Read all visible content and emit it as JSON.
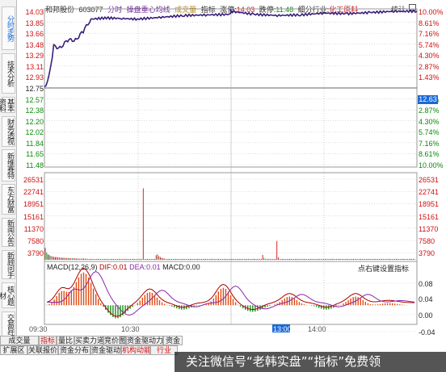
{
  "header": {
    "stock_name": "和邦股份",
    "stock_code": "603077",
    "time_label": "分时",
    "avg_label": "操盘重心均线",
    "vol_label": "成交量",
    "index_label": "指标",
    "up_label": "涨停:",
    "up_value": "14.03",
    "down_label": "跌停:",
    "down_value": "11.48",
    "industry_label": "细分行业:",
    "industry_value": "化工原料",
    "stat_button": "统计"
  },
  "sidebar": {
    "items": [
      "分时走势",
      "技术分析",
      "基本资料",
      "财务透视",
      "新维赛特",
      "东方财富",
      "新闻公告",
      "新顾问手",
      "核心题材",
      "交易异动",
      "公告"
    ]
  },
  "price_axis": {
    "left": [
      "14.03",
      "13.85",
      "13.66",
      "13.48",
      "13.29",
      "13.11",
      "12.93",
      "12.75",
      "12.57",
      "12.38",
      "12.20",
      "12.02",
      "11.84",
      "11.65",
      "11.48"
    ],
    "right": [
      "10.00%",
      "8.61%",
      "7.16%",
      "5.74%",
      "4.30%",
      "2.87%",
      "1.43%",
      "12.63",
      "1.43%",
      "2.87%",
      "4.30%",
      "5.74%",
      "7.16%",
      "8.61%",
      "10.00%"
    ],
    "current_price": "12.63"
  },
  "volume_axis": {
    "left": [
      "26531",
      "22741",
      "18951",
      "15161",
      "11370",
      "7580",
      "3790"
    ],
    "right": [
      "26531",
      "22741",
      "18951",
      "15161",
      "11370",
      "7580",
      "3790"
    ]
  },
  "macd": {
    "title": "MACD(12,26,9)",
    "dif": "DIF:0.01",
    "dea": "DEA:0.01",
    "macd": "MACD:0.00",
    "hint": "点右键设置指标",
    "right_axis": [
      "0.08",
      "0.04",
      "0.00",
      "-0.04"
    ]
  },
  "time_axis": [
    "09:30",
    "10:30",
    "13:00",
    "14:00"
  ],
  "tabs_row1": [
    {
      "label": "成交量",
      "red": false
    },
    {
      "label": "指标",
      "red": true
    },
    {
      "label": "量比",
      "red": false
    },
    {
      "label": "买卖力道",
      "red": false
    },
    {
      "label": "竞价图",
      "red": false
    },
    {
      "label": "资金驱动力",
      "red": false
    },
    {
      "label": "资金",
      "red": false
    }
  ],
  "tabs_row2": [
    {
      "label": "扩展区",
      "red": false
    },
    {
      "label": "关联报价",
      "red": false
    },
    {
      "label": "资金分布",
      "red": false
    },
    {
      "label": "资金驱动",
      "red": false
    },
    {
      "label": "机构动能",
      "red": true
    },
    {
      "label": "行业",
      "red": true
    }
  ],
  "watermark": "关注微信号“老韩实盘”“指标”免费领",
  "colors": {
    "price_line": "#3a1f7a",
    "up": "#d01010",
    "down": "#0a8a0a",
    "dif": "#b00000",
    "dea": "#8a2aa8",
    "accent": "#1a6ad6"
  },
  "chart_data": {
    "type": "line",
    "price_series": {
      "x": [
        "09:30",
        "09:33",
        "09:36",
        "09:40",
        "09:45",
        "09:50",
        "09:55",
        "10:00",
        "10:10",
        "10:20",
        "10:30",
        "10:45",
        "11:00",
        "11:15",
        "11:30",
        "13:00",
        "13:15",
        "13:30",
        "13:45",
        "14:00",
        "14:15",
        "14:30",
        "14:45",
        "15:00"
      ],
      "y": [
        12.75,
        12.95,
        13.45,
        13.42,
        13.55,
        13.55,
        13.7,
        13.9,
        13.92,
        13.91,
        13.9,
        13.93,
        13.96,
        13.97,
        13.98,
        14.03,
        13.98,
        13.96,
        13.97,
        14.0,
        13.99,
        14.01,
        14.03,
        14.03
      ]
    },
    "ylim": [
      11.48,
      14.03
    ],
    "prev_close": 12.75,
    "volume": {
      "max": 26531,
      "values": [
        3900,
        2400,
        1800,
        1500,
        1300,
        1100,
        1000,
        900,
        900,
        800,
        800,
        700,
        700,
        700,
        600,
        600,
        600,
        500,
        500,
        500,
        500,
        500,
        400,
        400,
        400,
        400,
        400,
        400,
        400,
        400,
        300,
        300,
        300,
        300,
        300,
        300,
        300,
        300,
        300,
        300,
        300,
        300,
        300,
        300,
        300,
        300,
        300,
        300,
        300,
        300,
        300,
        300,
        300,
        300,
        300,
        300,
        300,
        300,
        300,
        300,
        300,
        300,
        300,
        300,
        300,
        300,
        300,
        300,
        300,
        23500,
        300,
        300,
        300,
        300,
        300,
        300,
        300,
        300,
        1500,
        1800,
        1200,
        900,
        600,
        500,
        400,
        300,
        300,
        300,
        300,
        300,
        300,
        300,
        300,
        300,
        300,
        300,
        300,
        300,
        300,
        300,
        300,
        300,
        300,
        300,
        300,
        300,
        300,
        300,
        300,
        300,
        300,
        300,
        300,
        300,
        300,
        300,
        300,
        300,
        300,
        300,
        300,
        300,
        300,
        300,
        300,
        300,
        300,
        300,
        300,
        300,
        300,
        300,
        300,
        300,
        300,
        300,
        300,
        300,
        300,
        300,
        300,
        300,
        300,
        300,
        300,
        300,
        300,
        300,
        300,
        300,
        300,
        300,
        300,
        1600,
        600,
        300,
        300,
        300,
        300,
        300,
        300,
        300,
        300,
        6200,
        800,
        300,
        300,
        300,
        300,
        300,
        300,
        300,
        300,
        300,
        300,
        300,
        300,
        300,
        300,
        300,
        300,
        300,
        300,
        300,
        300,
        300,
        300,
        300,
        300,
        300,
        300,
        300,
        300,
        300,
        300,
        300,
        300,
        300,
        300,
        300,
        300,
        300,
        300,
        300,
        300,
        300,
        300,
        300,
        300,
        300,
        300,
        300,
        300,
        300,
        300,
        300,
        300,
        300,
        300,
        300,
        300,
        300,
        300,
        300,
        300,
        300,
        300,
        300,
        300,
        300,
        300,
        300,
        300,
        300,
        300,
        300,
        300,
        300,
        300,
        300,
        300,
        300,
        300,
        300,
        300,
        300,
        300,
        300,
        300,
        300,
        300,
        300,
        300,
        300,
        300,
        300,
        300,
        300,
        300,
        300,
        300
      ]
    },
    "macd_ylim": [
      -0.04,
      0.08
    ]
  }
}
